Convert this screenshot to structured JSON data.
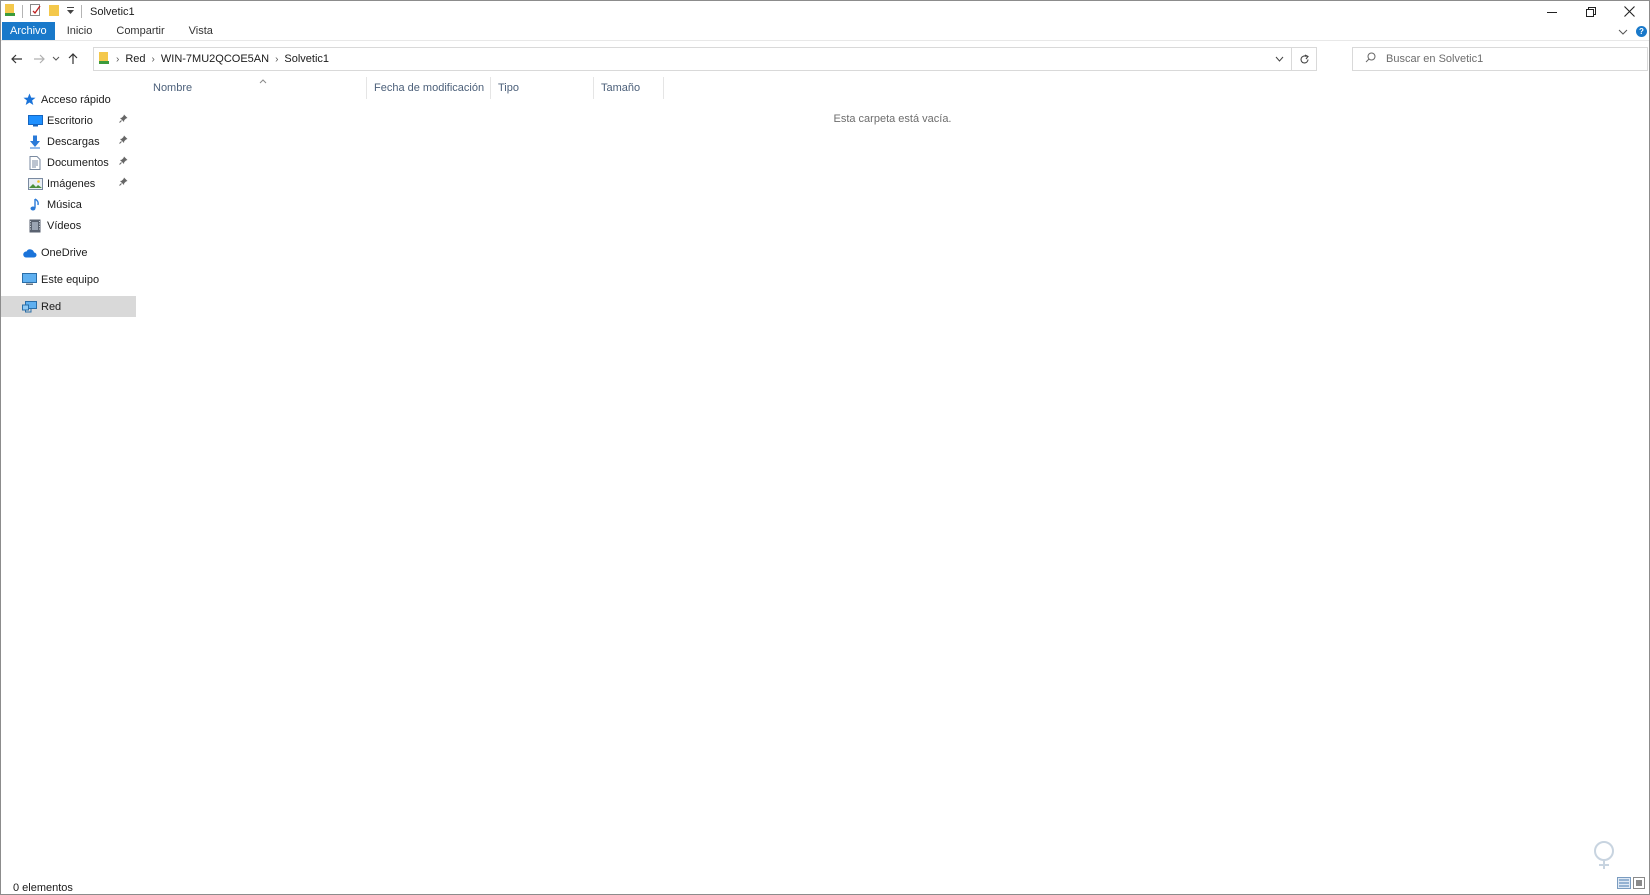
{
  "window": {
    "title": "Solvetic1"
  },
  "ribbon": {
    "tabs": [
      "Archivo",
      "Inicio",
      "Compartir",
      "Vista"
    ]
  },
  "address": {
    "crumbs": [
      "Red",
      "WIN-7MU2QCOE5AN",
      "Solvetic1"
    ]
  },
  "search": {
    "placeholder": "Buscar en Solvetic1"
  },
  "sidebar": {
    "quick_access": "Acceso rápido",
    "items": [
      {
        "label": "Escritorio",
        "icon": "desktop-icon",
        "pinned": true
      },
      {
        "label": "Descargas",
        "icon": "downloads-icon",
        "pinned": true
      },
      {
        "label": "Documentos",
        "icon": "documents-icon",
        "pinned": true
      },
      {
        "label": "Imágenes",
        "icon": "pictures-icon",
        "pinned": true
      },
      {
        "label": "Música",
        "icon": "music-icon",
        "pinned": false
      },
      {
        "label": "Vídeos",
        "icon": "videos-icon",
        "pinned": false
      }
    ],
    "onedrive": "OneDrive",
    "this_pc": "Este equipo",
    "network": "Red"
  },
  "columns": [
    "Nombre",
    "Fecha de modificación",
    "Tipo",
    "Tamaño"
  ],
  "content": {
    "empty_message": "Esta carpeta está vacía."
  },
  "status": {
    "count": "0 elementos"
  },
  "colors": {
    "accent": "#1979ca",
    "selected": "#d9d9d9",
    "header_text": "#4c607a"
  }
}
